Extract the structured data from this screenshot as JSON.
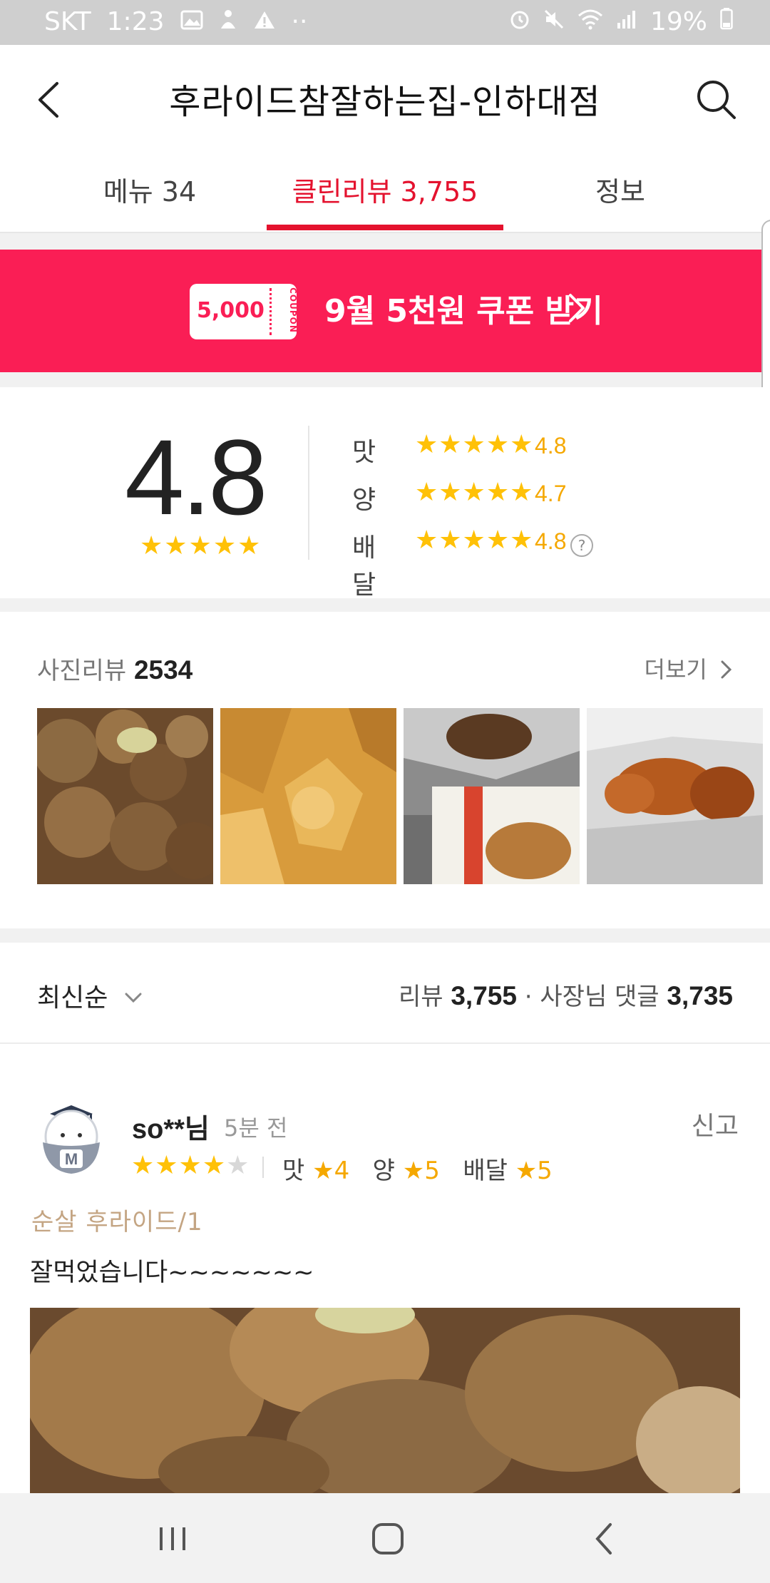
{
  "status_bar": {
    "carrier": "SKT",
    "time": "1:23",
    "battery": "19%"
  },
  "header": {
    "title": "후라이드참잘하는집-인하대점"
  },
  "tabs": [
    {
      "label": "메뉴 34",
      "active": false
    },
    {
      "label": "클린리뷰 3,755",
      "active": true
    },
    {
      "label": "정보",
      "active": false
    }
  ],
  "coupon": {
    "amount": "5,000",
    "tag": "COUPON",
    "text": "9월 5천원 쿠폰 받기"
  },
  "rating": {
    "overall": "4.8",
    "overall_stars": 5,
    "rows": [
      {
        "label": "맛",
        "value": "4.8",
        "stars": 5
      },
      {
        "label": "양",
        "value": "4.7",
        "stars": 5
      },
      {
        "label": "배달",
        "value": "4.8",
        "stars": 5
      }
    ],
    "help": "?"
  },
  "photo_reviews": {
    "label": "사진리뷰",
    "count": "2534",
    "more": "더보기"
  },
  "sort": {
    "selected": "최신순",
    "review_label": "리뷰",
    "review_count": "3,755",
    "owner_label": "· 사장님 댓글",
    "owner_count": "3,735"
  },
  "review": {
    "user": "so**님",
    "time": "5분 전",
    "report": "신고",
    "stars": 4,
    "taste_label": "맛",
    "taste": "4",
    "amount_label": "양",
    "amount": "5",
    "delivery_label": "배달",
    "delivery": "5",
    "menu": "순살 후라이드/1",
    "text": "잘먹었습니다~~~~~~~"
  },
  "colors": {
    "accent": "#e4122e",
    "coupon_bg": "#fa1e55",
    "star": "#ffc107"
  }
}
